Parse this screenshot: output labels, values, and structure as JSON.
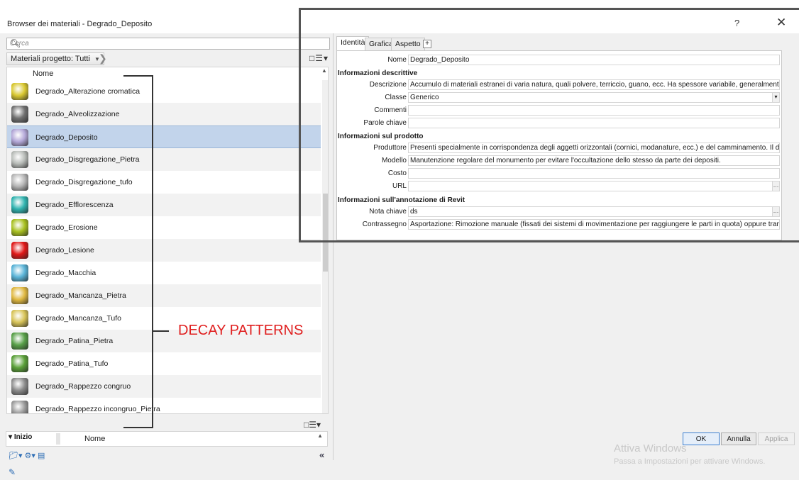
{
  "window": {
    "title": "Browser dei materiali - Degrado_Deposito",
    "help_label": "?",
    "close_label": "✕"
  },
  "search": {
    "placeholder": "Cerca",
    "icon": "magnifier-icon"
  },
  "filter": {
    "label": "Materiali progetto: Tutti",
    "dropdown_glyph": "▼"
  },
  "list": {
    "header": "Nome",
    "items": [
      {
        "label": "Degrado_Alterazione cromatica",
        "color": "#d9c830"
      },
      {
        "label": "Degrado_Alveolizzazione",
        "color": "#707070"
      },
      {
        "label": "Degrado_Deposito",
        "color": "#b4a8d8"
      },
      {
        "label": "Degrado_Disgregazione_Pietra",
        "color": "#b8bcb8"
      },
      {
        "label": "Degrado_Disgregazione_tufo",
        "color": "#b6b6b6"
      },
      {
        "label": "Degrado_Efflorescenza",
        "color": "#30b4b0"
      },
      {
        "label": "Degrado_Erosione",
        "color": "#a8c020"
      },
      {
        "label": "Degrado_Lesione",
        "color": "#e01818"
      },
      {
        "label": "Degrado_Macchia",
        "color": "#5ab4d8"
      },
      {
        "label": "Degrado_Mancanza_Pietra",
        "color": "#e0b840"
      },
      {
        "label": "Degrado_Mancanza_Tufo",
        "color": "#d8c458"
      },
      {
        "label": "Degrado_Patina_Pietra",
        "color": "#58a048"
      },
      {
        "label": "Degrado_Patina_Tufo",
        "color": "#5aa038"
      },
      {
        "label": "Degrado_Rappezzo congruo",
        "color": "#8c8c8c"
      },
      {
        "label": "Degrado_Rappezzo incongruo_Pietra",
        "color": "#9a9a9a"
      }
    ],
    "selected_index": 2
  },
  "library": {
    "section_label": "Inizio",
    "column_label": "Nome",
    "collapse_label": "«"
  },
  "tabs": [
    {
      "label": "Identità",
      "active": true
    },
    {
      "label": "Grafica",
      "active": false
    },
    {
      "label": "Aspetto",
      "active": false
    }
  ],
  "tab_add_label": "+",
  "properties": {
    "name_label": "Nome",
    "name_value": "Degrado_Deposito",
    "sections": [
      {
        "title": "Informazioni descrittive",
        "rows": [
          {
            "key": "Descrizione",
            "value": "Accumulo di materiali estranei di varia natura, quali polvere, terriccio, guano, ecc. Ha spessore variabile, generalmente scarsa ..."
          },
          {
            "key": "Classe",
            "value": "Generico"
          },
          {
            "key": "Commenti",
            "value": ""
          },
          {
            "key": "Parole chiave",
            "value": ""
          }
        ]
      },
      {
        "title": "Informazioni sul prodotto",
        "rows": [
          {
            "key": "Produttore",
            "value": "Presenti specialmente in corrispondenza degli aggetti orizzontali (cornici, modanature, ecc.) e del camminamento. Il deposit..."
          },
          {
            "key": "Modello",
            "value": "Manutenzione regolare del monumento per evitare l'occultazione dello stesso da parte dei depositi."
          },
          {
            "key": "Costo",
            "value": ""
          },
          {
            "key": "URL",
            "value": ""
          }
        ]
      },
      {
        "title": "Informazioni sull'annotazione di Revit",
        "rows": [
          {
            "key": "Nota chiave",
            "value": "ds"
          },
          {
            "key": "Contrassegno",
            "value": "Asportazione: Rimozione manuale (fissati dei sistemi di movimentazione per raggiungere le parti in quota) oppure tramite a..."
          }
        ]
      }
    ]
  },
  "watermark": {
    "line1": "Attiva Windows",
    "line2": "Passa a Impostazioni per attivare Windows."
  },
  "buttons": {
    "ok": "OK",
    "cancel": "Annulla",
    "apply": "Applica"
  },
  "annotation": {
    "label": "DECAY PATTERNS",
    "color": "#e02020"
  }
}
